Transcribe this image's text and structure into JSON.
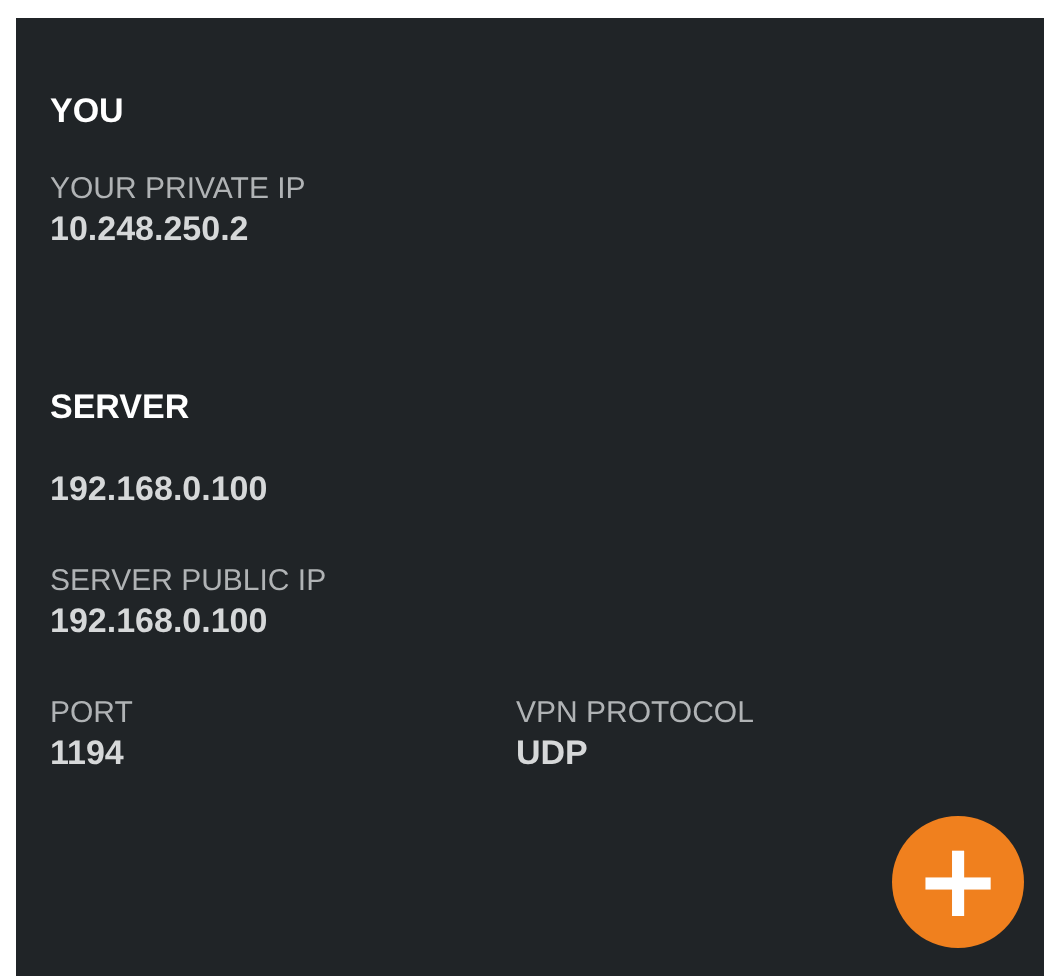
{
  "sections": [
    {
      "title": "YOU",
      "rows": [
        [
          {
            "label": "YOUR PRIVATE IP",
            "value": "10.248.250.2"
          }
        ]
      ]
    },
    {
      "title": "SERVER",
      "rows": [
        [
          {
            "value": "192.168.0.100"
          }
        ],
        [
          {
            "label": "SERVER PUBLIC IP",
            "value": "192.168.0.100"
          }
        ],
        [
          {
            "label": "PORT",
            "value": "1194"
          },
          {
            "label": "VPN PROTOCOL",
            "value": "UDP"
          }
        ]
      ]
    }
  ],
  "add_button": {
    "symbol": "+"
  }
}
